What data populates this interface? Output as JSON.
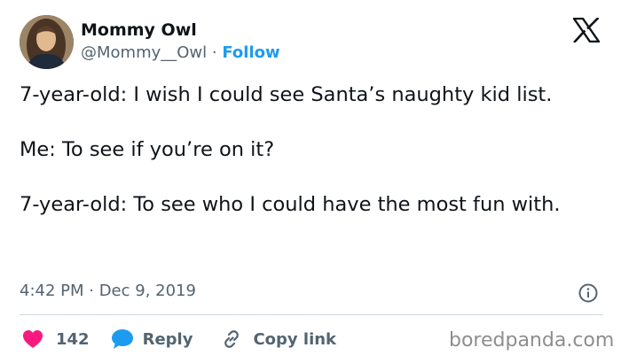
{
  "user": {
    "display_name": "Mommy Owl",
    "handle": "@Mommy__Owl",
    "separator": "·",
    "follow_label": "Follow"
  },
  "tweet": {
    "paragraphs": [
      "7-year-old: I wish I could see Santa’s naughty kid list.",
      "Me: To see if you’re on it?",
      "7-year-old: To see who I could have the most fun with."
    ],
    "timestamp": "4:42 PM · Dec 9, 2019"
  },
  "actions": {
    "like_count": "142",
    "reply_label": "Reply",
    "copy_link_label": "Copy link"
  },
  "icons": {
    "brand": "x-logo-icon",
    "info": "info-icon",
    "like": "heart-icon",
    "reply": "speech-bubble-icon",
    "copy": "link-icon"
  },
  "colors": {
    "text": "#0f1419",
    "secondary": "#536471",
    "accent": "#1d9bf0",
    "like": "#f91880",
    "divider": "#cfd9de"
  },
  "watermark": "boredpanda.com"
}
